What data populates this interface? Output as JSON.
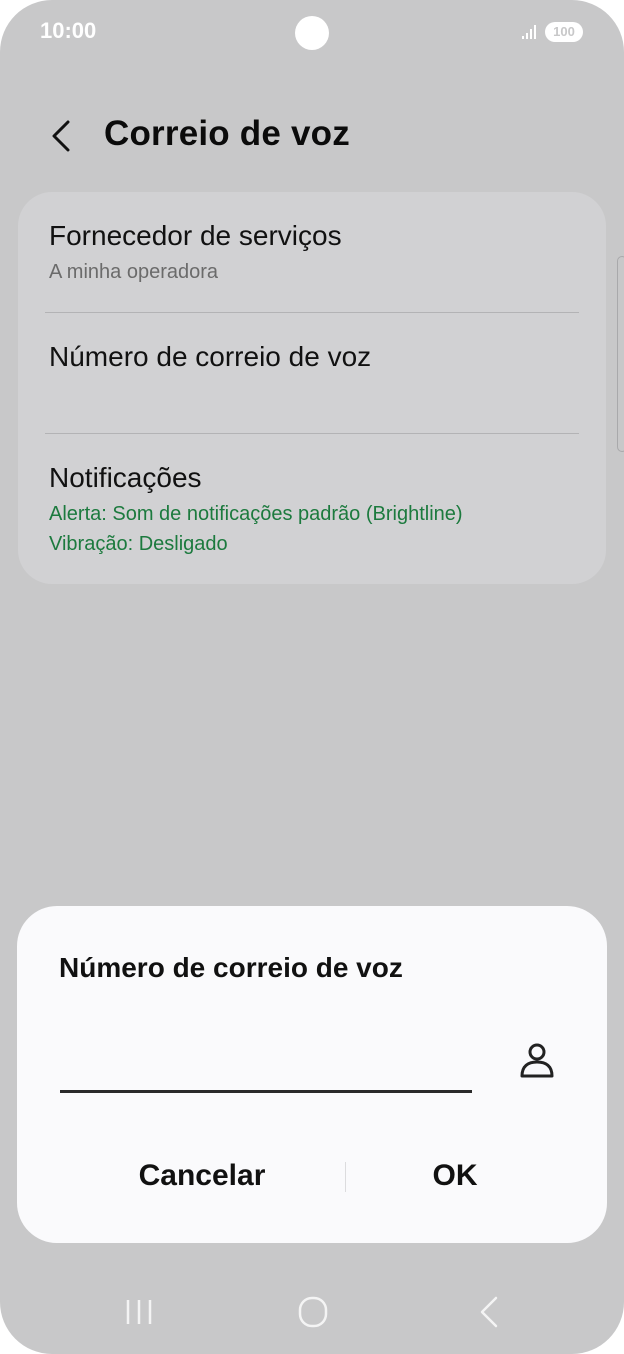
{
  "status_bar": {
    "time": "10:00",
    "battery": "100",
    "signal_icon": "signal-bars-icon"
  },
  "header": {
    "title": "Correio de voz",
    "back_icon": "chevron-left-icon"
  },
  "settings": {
    "items": [
      {
        "title": "Fornecedor de serviços",
        "subtitle": "A minha operadora"
      },
      {
        "title": "Número de correio de voz"
      },
      {
        "title": "Notificações",
        "details": [
          "Alerta: Som de notificações padrão (Brightline)",
          "Vibração: Desligado"
        ]
      }
    ]
  },
  "dialog": {
    "title": "Número de correio de voz",
    "input_value": "",
    "contact_icon": "person-icon",
    "cancel_label": "Cancelar",
    "ok_label": "OK"
  },
  "nav_bar": {
    "icons": [
      "recent-apps-icon",
      "home-icon",
      "back-icon"
    ]
  },
  "colors": {
    "background_dim": "#c8c8c9",
    "card": "#d1d1d3",
    "dialog": "#fafafc",
    "accent_green": "#1c7a3e"
  }
}
